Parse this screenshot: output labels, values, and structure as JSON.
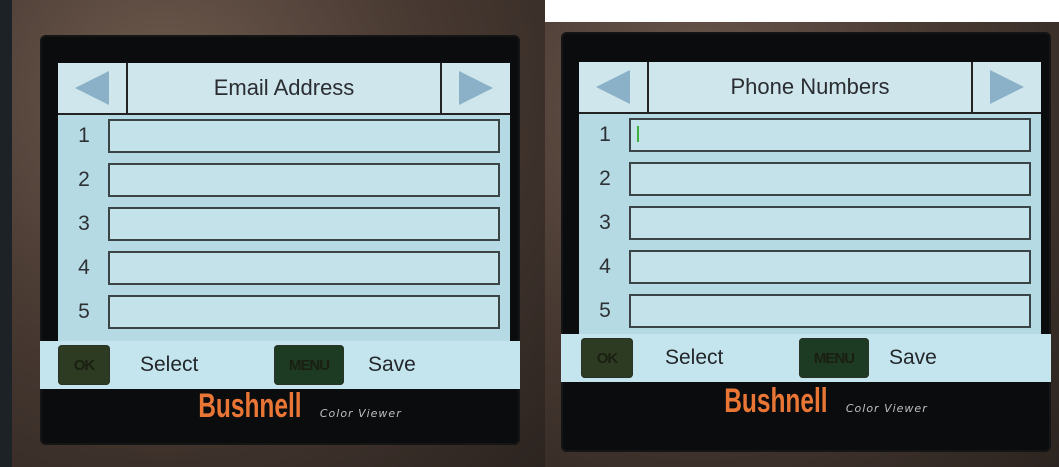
{
  "panels": [
    {
      "title": "Email Address",
      "rows": [
        "1",
        "2",
        "3",
        "4",
        "5"
      ],
      "footer": {
        "ok_label": "OK",
        "select_label": "Select",
        "menu_label": "MENU",
        "save_label": "Save"
      },
      "brand": {
        "logo": "Bushnell",
        "subtitle": "Color Viewer"
      }
    },
    {
      "title": "Phone Numbers",
      "rows": [
        "1",
        "2",
        "3",
        "4",
        "5"
      ],
      "footer": {
        "ok_label": "OK",
        "select_label": "Select",
        "menu_label": "MENU",
        "save_label": "Save"
      },
      "brand": {
        "logo": "Bushnell",
        "subtitle": "Color Viewer"
      }
    }
  ],
  "icons": {
    "prev": "left-arrow-icon",
    "next": "right-arrow-icon"
  },
  "colors": {
    "lcd_background": "#b6dae3",
    "arrow": "#8ab1c8",
    "brand": "#ea7635",
    "ok_button": "#2d3b22",
    "menu_button": "#1d3b23"
  }
}
